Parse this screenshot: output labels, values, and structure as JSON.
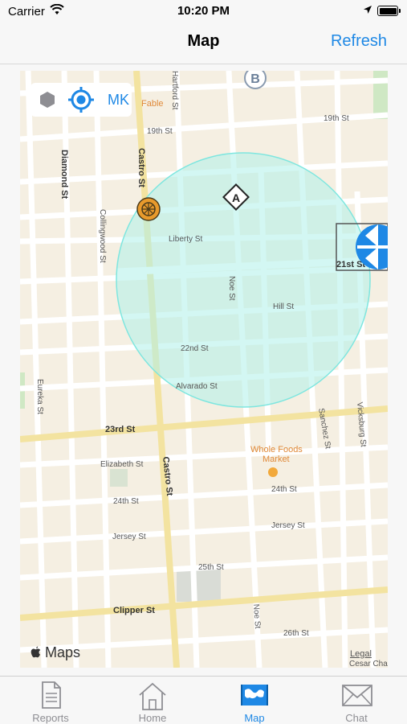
{
  "status_bar": {
    "carrier": "Carrier",
    "time": "10:20 PM"
  },
  "nav": {
    "title": "Map",
    "refresh_label": "Refresh"
  },
  "map": {
    "overlay_label": "MK",
    "attribution": "Maps",
    "legal": "Legal",
    "labels": {
      "fable": "Fable",
      "st_19th": "19th St",
      "st_19th_b": "19th St",
      "hartford": "Hartford St",
      "diamond": "Diamond St",
      "castro": "Castro St",
      "castro_b": "Castro St",
      "collingwood": "Collingwood St",
      "liberty": "Liberty St",
      "st_21st": "21st St",
      "noe": "Noe St",
      "noe_b": "Noe St",
      "hill": "Hill St",
      "st_22nd": "22nd St",
      "alvarado": "Alvarado St",
      "eureka": "Eureka St",
      "st_23rd": "23rd St",
      "whole_foods_1": "Whole Foods",
      "whole_foods_2": "Market",
      "sanchez": "Sanchez St",
      "vicksburg": "Vicksburg St",
      "elizabeth": "Elizabeth St",
      "st_24th": "24th St",
      "st_24th_b": "24th St",
      "jersey": "Jersey St",
      "jersey_b": "Jersey St",
      "st_25th": "25th St",
      "clipper": "Clipper St",
      "st_26th": "26th St",
      "cesar": "Cesar Cha",
      "marker_a": "A",
      "marker_b": "B"
    }
  },
  "tabs": [
    {
      "label": "Reports",
      "icon": "document-icon"
    },
    {
      "label": "Home",
      "icon": "house-icon"
    },
    {
      "label": "Map",
      "icon": "map-icon"
    },
    {
      "label": "Chat",
      "icon": "envelope-icon"
    }
  ],
  "colors": {
    "accent": "#1e88e5",
    "radius_fill": "#aef0ea",
    "map_bg": "#f5efe2",
    "main_road": "#f6e7a6"
  }
}
